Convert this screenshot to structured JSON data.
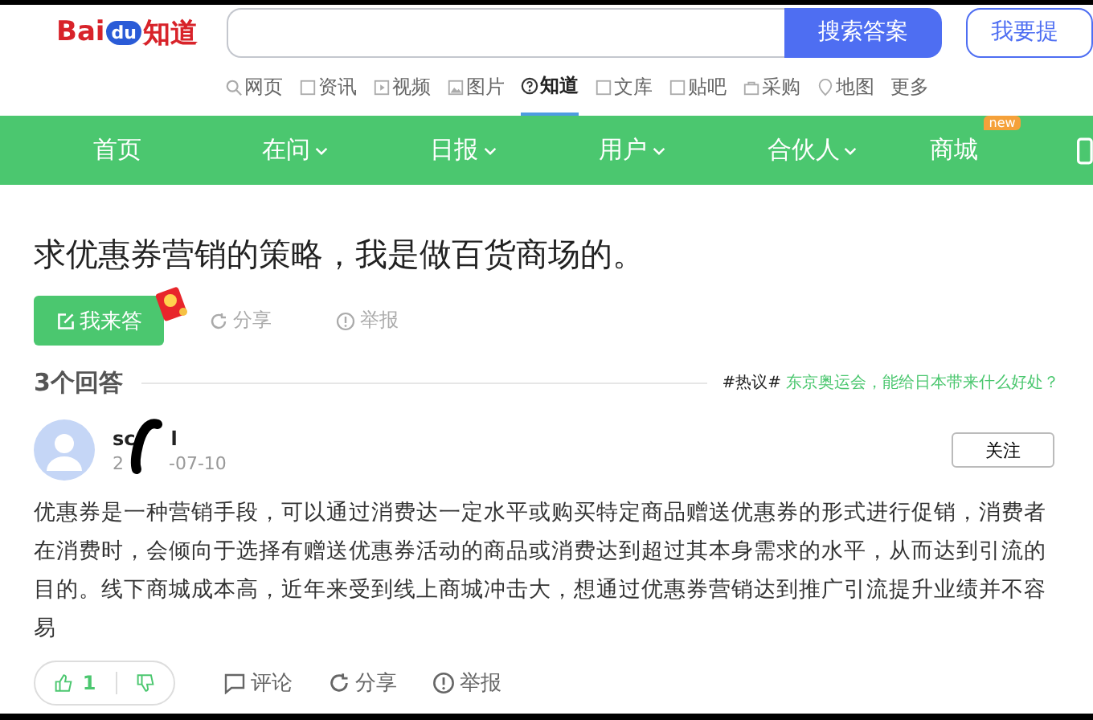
{
  "header": {
    "logo_text": "Bai",
    "logo_paw": "du",
    "logo_suffix": "知道",
    "search": {
      "button": "搜索答案"
    },
    "ask_button": "我要提"
  },
  "channels": [
    {
      "label": "网页",
      "kind": "search",
      "selected": false
    },
    {
      "label": "资讯",
      "kind": "doc",
      "selected": false
    },
    {
      "label": "视频",
      "kind": "play",
      "selected": false
    },
    {
      "label": "图片",
      "kind": "image",
      "selected": false
    },
    {
      "label": "知道",
      "kind": "question",
      "selected": true
    },
    {
      "label": "文库",
      "kind": "doc",
      "selected": false
    },
    {
      "label": "贴吧",
      "kind": "doc",
      "selected": false
    },
    {
      "label": "采购",
      "kind": "bag",
      "selected": false
    },
    {
      "label": "地图",
      "kind": "pin",
      "selected": false
    },
    {
      "label": "更多",
      "kind": "text",
      "selected": false
    }
  ],
  "nav": [
    {
      "label": "首页",
      "dropdown": false
    },
    {
      "label": "在问",
      "dropdown": true
    },
    {
      "label": "日报",
      "dropdown": true
    },
    {
      "label": "用户",
      "dropdown": true
    },
    {
      "label": "合伙人",
      "dropdown": true
    },
    {
      "label": "商城",
      "dropdown": false,
      "badge": "new"
    }
  ],
  "question": {
    "title": "求优惠券营销的策略，我是做百货商场的。",
    "answer_button": "我来答",
    "share": "分享",
    "report": "举报"
  },
  "answers_header": {
    "count": "3个回答",
    "hot_tag": "#热议#",
    "hot_link": "东京奥运会，能给日本带来什么好处？"
  },
  "answer": {
    "user": "sc",
    "user_tail": "l",
    "date_head": "2",
    "date": "-07-10",
    "follow": "关注",
    "body": "优惠券是一种营销手段，可以通过消费达一定水平或购买特定商品赠送优惠券的形式进行促销，消费者在消费时，会倾向于选择有赠送优惠券活动的商品或消费达到超过其本身需求的水平，从而达到引流的目的。线下商城成本高，近年来受到线上商城冲击大，想通过优惠券营销达到推广引流提升业绩并不容易",
    "likes": "1",
    "comment": "评论",
    "share": "分享",
    "report": "举报"
  }
}
